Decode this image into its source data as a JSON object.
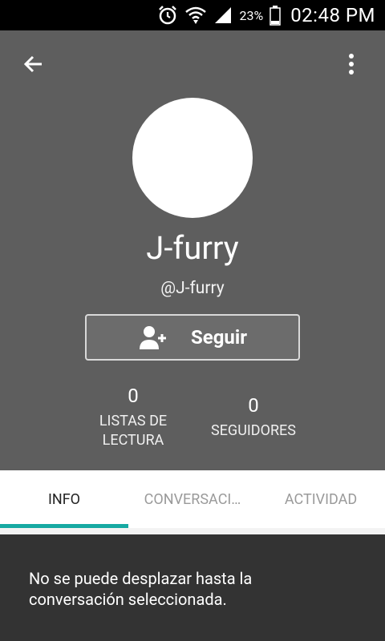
{
  "status_bar": {
    "battery_percent": "23%",
    "time": "02:48 PM",
    "icons": [
      "alarm-icon",
      "wifi-icon",
      "signal-icon",
      "battery-icon"
    ]
  },
  "profile": {
    "display_name": "J-furry",
    "username": "@J-furry",
    "follow_label": "Seguir",
    "stats": {
      "reading_lists": {
        "count": "0",
        "label_line1": "LISTAS DE",
        "label_line2": "LECTURA"
      },
      "followers": {
        "count": "0",
        "label": "SEGUIDORES"
      }
    }
  },
  "tabs": [
    {
      "label": "INFO",
      "active": true
    },
    {
      "label": "CONVERSACI…",
      "active": false
    },
    {
      "label": "ACTIVIDAD",
      "active": false
    }
  ],
  "toast": {
    "line1": "No se puede desplazar hasta la",
    "line2": "conversación seleccionada."
  },
  "colors": {
    "header_bg": "#5e5e5e",
    "tab_indicator": "#16a9a2",
    "toast_bg": "#333333"
  }
}
